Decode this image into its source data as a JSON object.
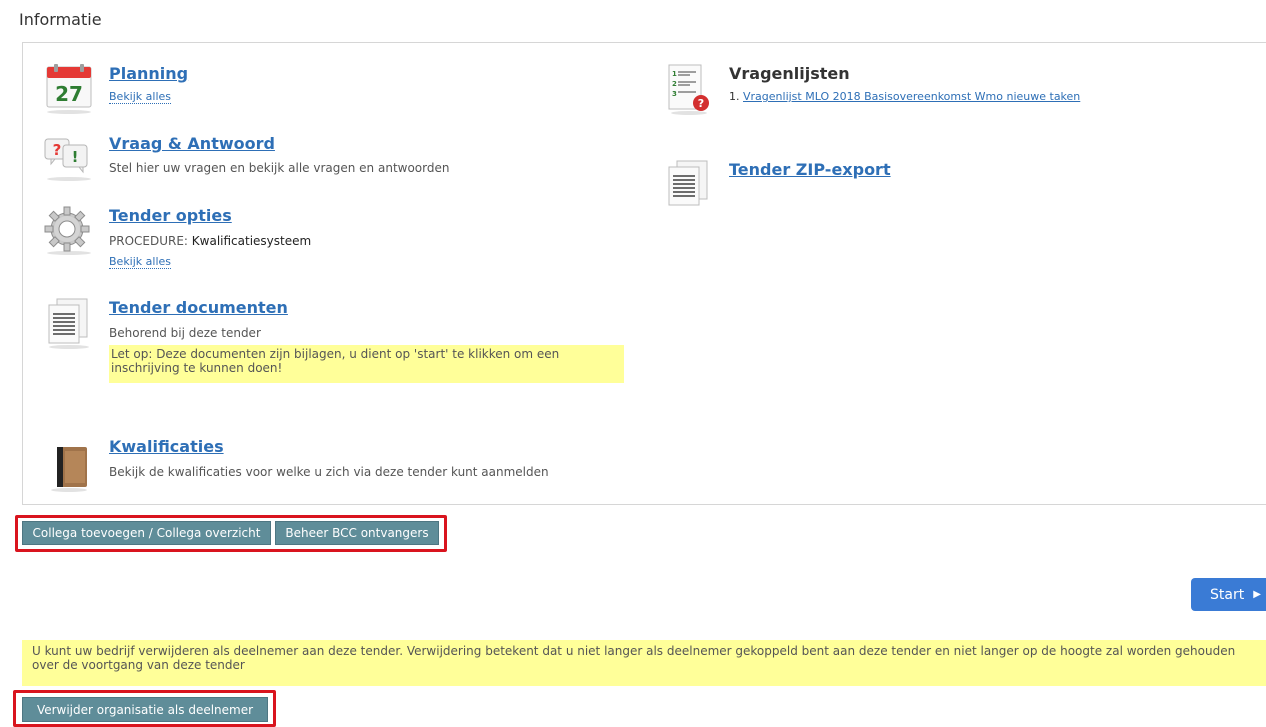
{
  "section": {
    "title": "Informatie"
  },
  "items": {
    "planning": {
      "title": "Planning",
      "link": "Bekijk alles",
      "calendar_day": "27"
    },
    "qa": {
      "title": "Vraag & Antwoord",
      "desc": "Stel hier uw vragen en bekijk alle vragen en antwoorden"
    },
    "options": {
      "title": "Tender opties",
      "procedure_label": "PROCEDURE:",
      "procedure_value": "Kwalificatiesysteem",
      "link": "Bekijk alles"
    },
    "documents": {
      "title": "Tender documenten",
      "desc": "Behorend bij deze tender",
      "note": "Let op: Deze documenten zijn bijlagen, u dient op 'start' te klikken om een inschrijving te kunnen doen!"
    },
    "qualifications": {
      "title": "Kwalificaties",
      "desc": "Bekijk de kwalificaties voor welke u zich via deze tender kunt aanmelden"
    },
    "questionnaires": {
      "title": "Vragenlijsten",
      "list": [
        {
          "num": "1.",
          "label": "Vragenlijst MLO 2018 Basisovereenkomst Wmo nieuwe taken"
        }
      ]
    },
    "zip_export": {
      "title": "Tender ZIP-export"
    }
  },
  "buttons": {
    "colleague": "Collega toevoegen / Collega overzicht",
    "bcc": "Beheer BCC ontvangers",
    "start": "Start",
    "remove_org": "Verwijder organisatie als deelnemer"
  },
  "info_bar": {
    "text": "U kunt uw bedrijf verwijderen als deelnemer aan deze tender. Verwijdering betekent dat u niet langer als deelnemer gekoppeld bent aan deze tender en niet langer op de hoogte zal worden gehouden over de voortgang van deze tender"
  },
  "colors": {
    "link": "#2e6fb6",
    "button": "#5f8d99",
    "start": "#3a7bd5",
    "highlight": "#ffff99",
    "outline": "#d9141e"
  }
}
